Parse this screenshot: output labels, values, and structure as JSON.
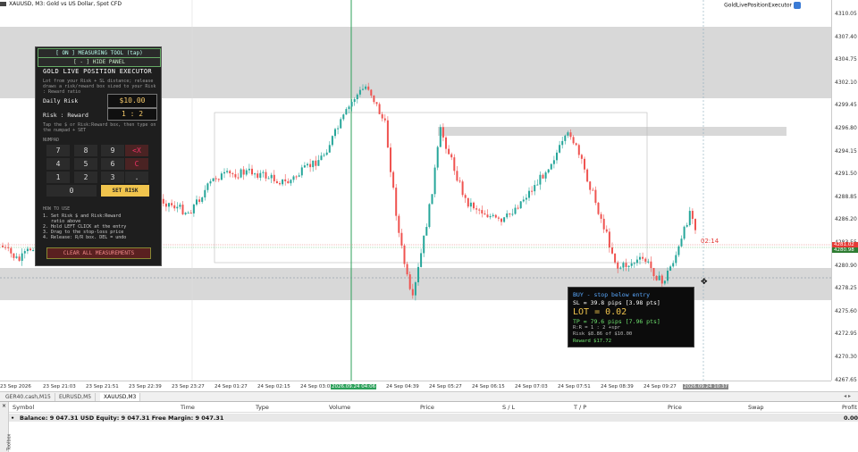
{
  "chart": {
    "symbol_title": "XAUUSD, M3:  Gold vs US Dollar, Spot CFD",
    "ea_name": "GoldLivePositionExecutor",
    "price_ticks": [
      "4310.05",
      "4307.40",
      "4304.75",
      "4302.10",
      "4299.45",
      "4296.80",
      "4294.15",
      "4291.50",
      "4288.85",
      "4286.20",
      "4283.55",
      "4280.90",
      "4278.25",
      "4275.60",
      "4272.95",
      "4270.30",
      "4267.65"
    ],
    "current_bid": "4281.02",
    "current_ask": "4280.98",
    "countdown": "02:14",
    "time_ticks": [
      "23 Sep 2026",
      "23 Sep 21:03",
      "23 Sep 21:51",
      "23 Sep 22:39",
      "23 Sep 23:27",
      "24 Sep 01:27",
      "24 Sep 02:15",
      "24 Sep 03:03",
      "2026.09.24 04:06",
      "24 Sep 04:39",
      "24 Sep 05:27",
      "24 Sep 06:15",
      "24 Sep 07:03",
      "24 Sep 07:51",
      "24 Sep 08:39",
      "24 Sep 09:27",
      "2026.09.24 10:37"
    ]
  },
  "panel": {
    "measuring_tool": "[ ON ]  MEASURING TOOL  (tap)",
    "hide_panel": "[ - ]  HIDE PANEL",
    "title": "GOLD LIVE POSITION EXECUTOR",
    "help_text": "Lot from your Risk + SL distance; release draws a risk/reward box sized to your Risk : Reward ratio",
    "daily_risk_label": "Daily Risk",
    "daily_risk_value": "$10.00",
    "rr_label": "Risk : Reward",
    "rr_value": "1 : 2",
    "tap_hint": "Tap the $ or Risk:Reward box, then type on the numpad + SET",
    "numpad_label": "NUMPAD",
    "keys": [
      "7",
      "8",
      "9",
      "<X",
      "4",
      "5",
      "6",
      "C",
      "1",
      "2",
      "3",
      ".",
      "0",
      "SET RISK"
    ],
    "howto_label": "HOW TO USE",
    "howto_steps": [
      "1. Set Risk $ and Risk:Reward",
      "   ratio above",
      "2. Hold LEFT CLICK at the entry",
      "3. Drag to the stop-loss price",
      "4. Release: R/R box. DEL = undo"
    ],
    "clear_button": "CLEAR ALL MEASUREMENTS"
  },
  "info_box": {
    "line1": "BUY  -  stop below entry",
    "line2": "SL  =  39.8 pips   [3.98 pts]",
    "line3": "LOT  =  0.02",
    "line4": "TP  =  79.6 pips   [7.96 pts]",
    "line5": "R:R  =  1 : 2       +spr",
    "line6": "Risk   $8.86  of  $10.00",
    "line7": "Reward  $17.72"
  },
  "tabs": [
    "GER40.cash,M15",
    "EURUSD,M5",
    "XAUUSD,M3"
  ],
  "terminal": {
    "columns": [
      "Symbol",
      "Time",
      "Type",
      "Volume",
      "Price",
      "S / L",
      "T / P",
      "Price",
      "Swap",
      "Profit"
    ],
    "balance_line": "Balance: 9 047.31 USD  Equity: 9 047.31  Free Margin: 9 047.31",
    "balance_profit": "0.00",
    "toolbox_label": "Toolbox"
  },
  "colors": {
    "bull": "#26a69a",
    "bear": "#ef5350",
    "panel_bg": "#1e1e1e",
    "accent": "#f0c44d"
  }
}
